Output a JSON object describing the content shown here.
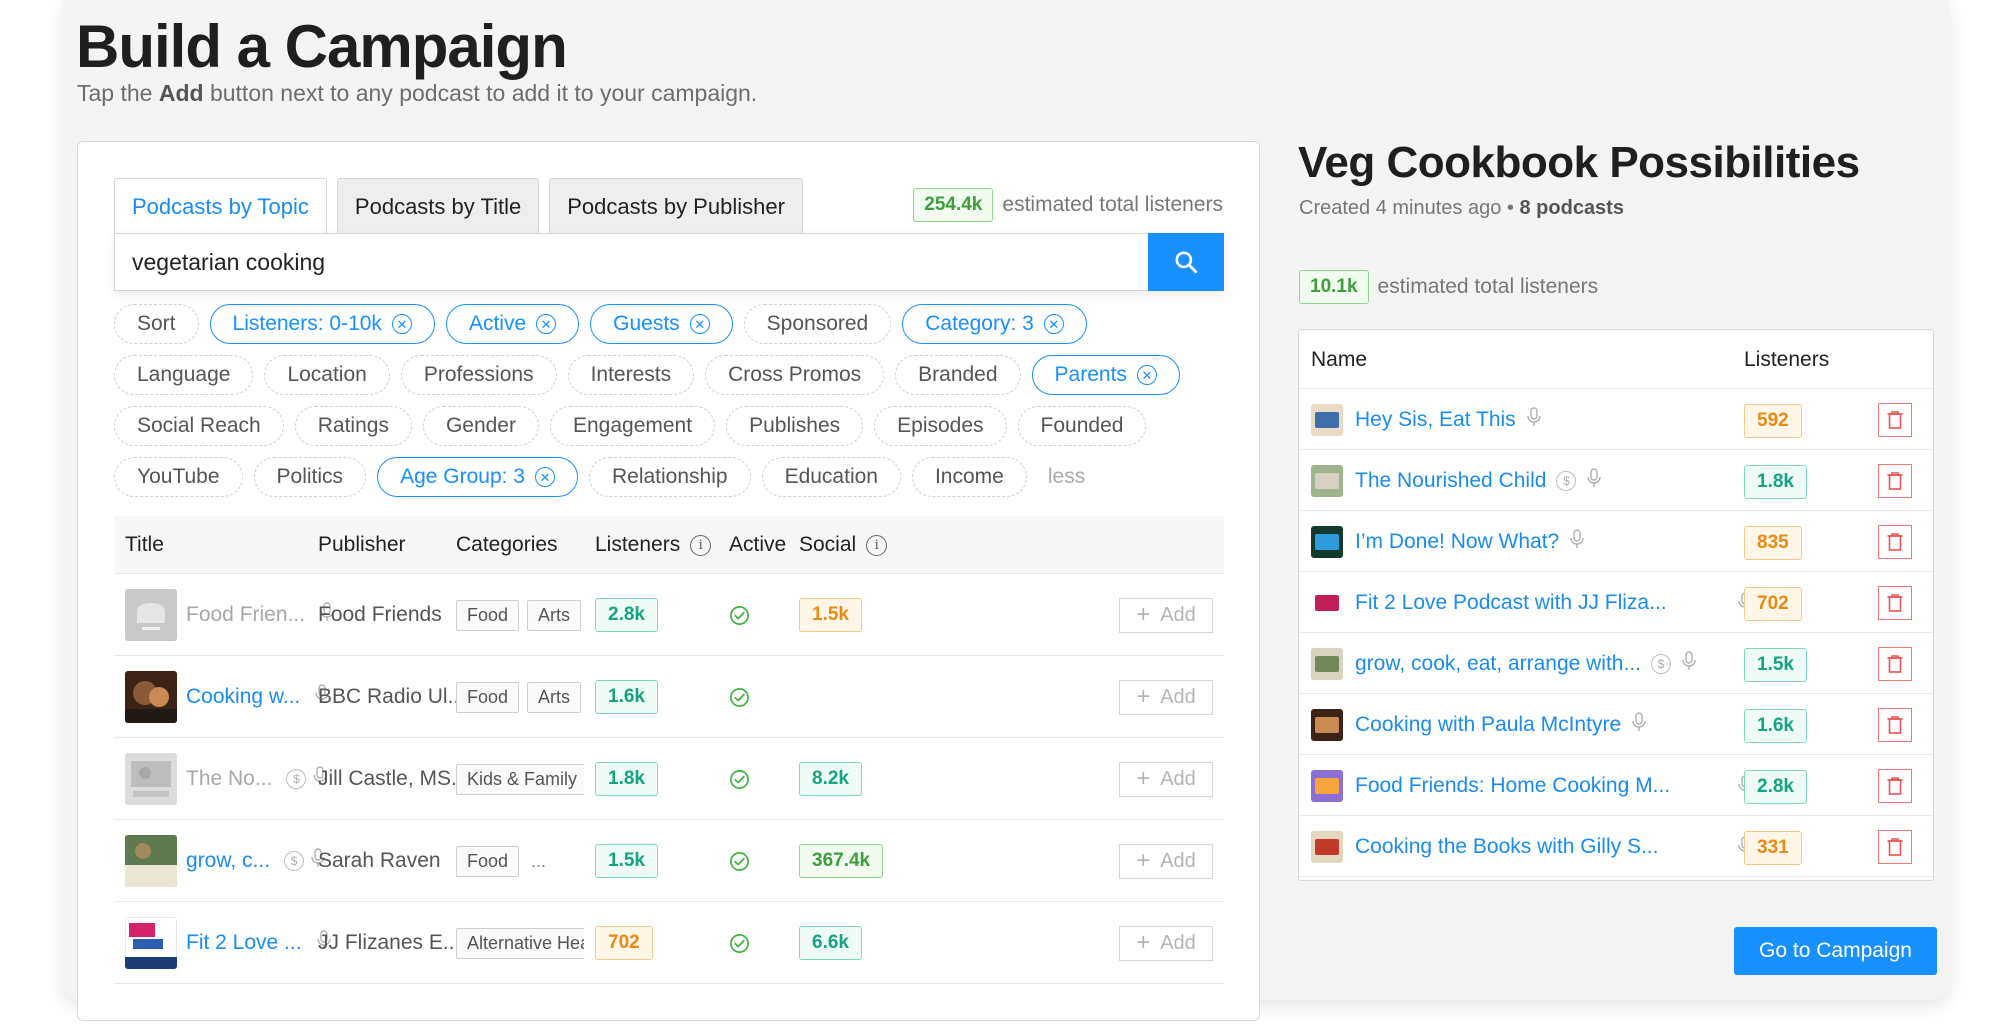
{
  "header": {
    "title": "Build a Campaign",
    "subtitle_pre": "Tap the ",
    "subtitle_bold": "Add",
    "subtitle_post": " button next to any podcast to add it to your campaign."
  },
  "search_panel": {
    "tabs": [
      {
        "label": "Podcasts by Topic",
        "active": true
      },
      {
        "label": "Podcasts by Title",
        "active": false
      },
      {
        "label": "Podcasts by Publisher",
        "active": false
      }
    ],
    "estimate_value": "254.4k",
    "estimate_label": "estimated total listeners",
    "search_value": "vegetarian cooking",
    "filter_rows": [
      [
        {
          "label": "Sort",
          "active": false
        },
        {
          "label": "Listeners: 0-10k",
          "active": true
        },
        {
          "label": "Active",
          "active": true
        },
        {
          "label": "Guests",
          "active": true
        },
        {
          "label": "Sponsored",
          "active": false
        },
        {
          "label": "Category: 3",
          "active": true
        }
      ],
      [
        {
          "label": "Language",
          "active": false
        },
        {
          "label": "Location",
          "active": false
        },
        {
          "label": "Professions",
          "active": false
        },
        {
          "label": "Interests",
          "active": false
        },
        {
          "label": "Cross Promos",
          "active": false
        },
        {
          "label": "Branded",
          "active": false
        },
        {
          "label": "Parents",
          "active": true
        }
      ],
      [
        {
          "label": "Social Reach",
          "active": false
        },
        {
          "label": "Ratings",
          "active": false
        },
        {
          "label": "Gender",
          "active": false
        },
        {
          "label": "Engagement",
          "active": false
        },
        {
          "label": "Publishes",
          "active": false
        },
        {
          "label": "Episodes",
          "active": false
        },
        {
          "label": "Founded",
          "active": false
        }
      ],
      [
        {
          "label": "YouTube",
          "active": false
        },
        {
          "label": "Politics",
          "active": false
        },
        {
          "label": "Age Group: 3",
          "active": true
        },
        {
          "label": "Relationship",
          "active": false
        },
        {
          "label": "Education",
          "active": false
        },
        {
          "label": "Income",
          "active": false
        }
      ]
    ],
    "less_label": "less",
    "columns": {
      "title": "Title",
      "publisher": "Publisher",
      "categories": "Categories",
      "listeners": "Listeners",
      "active": "Active",
      "social": "Social"
    },
    "add_label": "Add",
    "rows": [
      {
        "title": "Food Frien...",
        "muted": true,
        "sponsored": false,
        "publisher": "Food Friends",
        "categories": [
          "Food",
          "Arts"
        ],
        "more": "",
        "listeners": "2.8k",
        "listeners_color": "teal",
        "active": true,
        "social": "1.5k",
        "social_color": "orange"
      },
      {
        "title": "Cooking w...",
        "muted": false,
        "sponsored": false,
        "publisher": "BBC Radio Ul...",
        "categories": [
          "Food",
          "Arts"
        ],
        "more": "",
        "listeners": "1.6k",
        "listeners_color": "teal",
        "active": true,
        "social": "",
        "social_color": ""
      },
      {
        "title": "The No...",
        "muted": true,
        "sponsored": true,
        "publisher": "Jill Castle, MS...",
        "categories": [
          "Kids & Family"
        ],
        "more": "..",
        "listeners": "1.8k",
        "listeners_color": "teal",
        "active": true,
        "social": "8.2k",
        "social_color": "teal"
      },
      {
        "title": "grow, c...",
        "muted": false,
        "sponsored": true,
        "publisher": "Sarah Raven",
        "categories": [
          "Food"
        ],
        "more": "...",
        "listeners": "1.5k",
        "listeners_color": "teal",
        "active": true,
        "social": "367.4k",
        "social_color": "green"
      },
      {
        "title": "Fit 2 Love ...",
        "muted": false,
        "sponsored": false,
        "publisher": "JJ Flizanes E...",
        "categories": [
          "Alternative Health"
        ],
        "more": "",
        "listeners": "702",
        "listeners_color": "orange",
        "active": true,
        "social": "6.6k",
        "social_color": "teal"
      }
    ]
  },
  "campaign": {
    "title": "Veg Cookbook Possibilities",
    "created": "Created 4 minutes ago",
    "separator": "•",
    "count": "8 podcasts",
    "estimate_value": "10.1k",
    "estimate_label": "estimated total listeners",
    "columns": {
      "name": "Name",
      "listeners": "Listeners"
    },
    "rows": [
      {
        "name": "Hey Sis, Eat This",
        "sponsored": false,
        "listeners": "592",
        "color": "orange"
      },
      {
        "name": "The Nourished Child",
        "sponsored": true,
        "listeners": "1.8k",
        "color": "teal"
      },
      {
        "name": "I’m Done! Now What?",
        "sponsored": false,
        "listeners": "835",
        "color": "orange"
      },
      {
        "name": "Fit 2 Love Podcast with JJ Fliza...",
        "sponsored": false,
        "listeners": "702",
        "color": "orange"
      },
      {
        "name": "grow, cook, eat, arrange with...",
        "sponsored": true,
        "listeners": "1.5k",
        "color": "teal"
      },
      {
        "name": "Cooking with Paula McIntyre",
        "sponsored": false,
        "listeners": "1.6k",
        "color": "teal"
      },
      {
        "name": "Food Friends: Home Cooking M...",
        "sponsored": false,
        "listeners": "2.8k",
        "color": "teal"
      },
      {
        "name": "Cooking the Books with Gilly S...",
        "sponsored": false,
        "listeners": "331",
        "color": "orange"
      }
    ],
    "go_label": "Go to Campaign"
  },
  "colors": {
    "accent": "#1890ff",
    "teal": "#16a383",
    "orange": "#e98a12",
    "green": "#3e9e3e",
    "danger": "#f07b7b"
  }
}
